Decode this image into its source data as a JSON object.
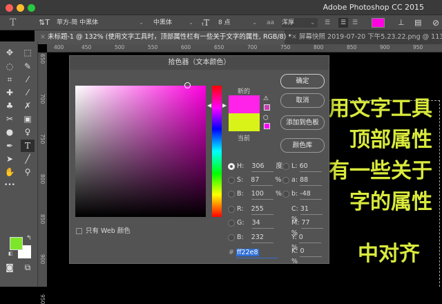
{
  "app": {
    "title": "Adobe Photoshop CC 2015"
  },
  "options": {
    "font_family": "苹方-简 中黑体",
    "font_style": "中黑体",
    "font_size": "8 点",
    "antialias_icon": "aa",
    "antialias": "浑厚",
    "text_color": "#ff00e0"
  },
  "tabs": [
    {
      "label": "未标题-1 @ 132% (使用文字工具时，顶部属性栏有一些关于文字的属性, RGB/8) *",
      "close": "×"
    },
    {
      "label": "屏幕快照 2019-07-20 下午5.23.22.png @ 113% (切",
      "close": "×"
    }
  ],
  "ruler": {
    "h": [
      "400",
      "450",
      "500",
      "550",
      "600",
      "650",
      "700",
      "750",
      "800",
      "850",
      "900",
      "950"
    ],
    "v": [
      "650",
      "700",
      "750",
      "800",
      "850",
      "900",
      "950"
    ]
  },
  "canvas": {
    "lines": [
      "用文字工具",
      "顶部属性",
      "有一些关于",
      "字的属性",
      "中对齐"
    ],
    "color": "#d9ea3c"
  },
  "toolbox": {
    "foreground": "#7ee62a",
    "background": "#ffffff",
    "more": "•••"
  },
  "dialog": {
    "title": "拾色器（文本颜色）",
    "new_label": "新的",
    "current_label": "当前",
    "new_color": "#ff22e8",
    "current_color": "#d9f218",
    "buttons": {
      "ok": "确定",
      "cancel": "取消",
      "add": "添加到色板",
      "library": "颜色库"
    },
    "web_only": "只有 Web 颜色",
    "hsb": [
      {
        "label": "H:",
        "value": "306",
        "unit": "度",
        "selected": true
      },
      {
        "label": "S:",
        "value": "87",
        "unit": "%"
      },
      {
        "label": "B:",
        "value": "100",
        "unit": "%"
      }
    ],
    "rgb": [
      {
        "label": "R:",
        "value": "255"
      },
      {
        "label": "G:",
        "value": "34"
      },
      {
        "label": "B:",
        "value": "232"
      }
    ],
    "lab": [
      {
        "label": "L:",
        "value": "60"
      },
      {
        "label": "a:",
        "value": "88"
      },
      {
        "label": "b:",
        "value": "-48"
      }
    ],
    "cmyk": [
      {
        "label": "C:",
        "value": "31",
        "unit": "%"
      },
      {
        "label": "M:",
        "value": "77",
        "unit": "%"
      },
      {
        "label": "Y:",
        "value": "0",
        "unit": "%"
      },
      {
        "label": "K:",
        "value": "0",
        "unit": "%"
      }
    ],
    "hex_prefix": "#",
    "hex": "ff22e8"
  }
}
